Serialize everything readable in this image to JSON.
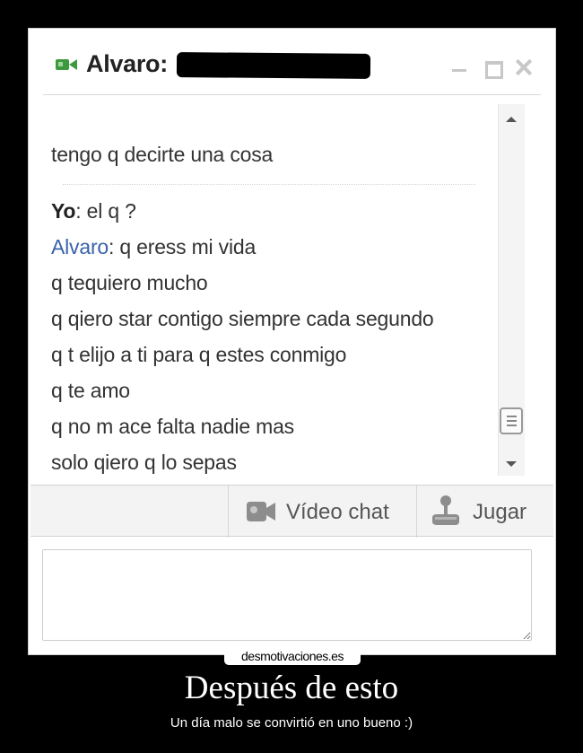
{
  "chat": {
    "contact_name": "Alvaro:",
    "messages": {
      "first": "tengo q decirte una cosa",
      "me_sender": "Yo",
      "me_text": ": el q ?",
      "contact_sender": "Alvaro",
      "contact_text": ": q eress mi vida",
      "lines": [
        "q tequiero mucho",
        "q qiero star contigo siempre cada segundo",
        "q t elijo a ti para q estes conmigo",
        "q te amo",
        "q no m ace falta nadie mas",
        "solo qiero q lo sepas"
      ]
    },
    "actions": {
      "video_chat_label": "Vídeo chat",
      "game_label": "Jugar"
    },
    "compose_value": ""
  },
  "poster": {
    "brand": "desmotivaciones.es",
    "title": "Después de esto",
    "subtitle": "Un día malo se convirtió en uno bueno :)"
  },
  "icons": {
    "title_icon": "video-camera-icon",
    "video_chat_icon": "webcam-icon",
    "game_icon": "joystick-icon"
  },
  "colors": {
    "contact_sender": "#3a63a8",
    "camera_icon": "#3e9a3e",
    "poster_background": "#000000"
  }
}
